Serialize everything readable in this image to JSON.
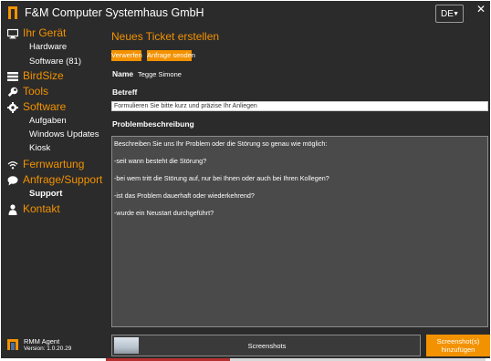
{
  "window": {
    "title": "F&M Computer Systemhaus GmbH"
  },
  "language": {
    "selected": "DE"
  },
  "sidebar": {
    "sections": [
      {
        "label": "Ihr Gerät",
        "icon": "monitor-icon"
      },
      {
        "label": "BirdSize",
        "icon": "list-icon"
      },
      {
        "label": "Tools",
        "icon": "wrench-icon"
      },
      {
        "label": "Software",
        "icon": "gear-icon"
      },
      {
        "label": "Fernwartung",
        "icon": "wifi-icon"
      },
      {
        "label": "Anfrage/Support",
        "icon": "chat-icon"
      },
      {
        "label": "Kontakt",
        "icon": "person-icon"
      }
    ],
    "device_items": [
      "Hardware",
      "Software (81)"
    ],
    "software_items": [
      "Aufgaben",
      "Windows Updates",
      "Kiosk"
    ],
    "support_items": [
      "Support"
    ]
  },
  "agent": {
    "name": "RMM Agent",
    "version": "Version:   1.0.20.29"
  },
  "main": {
    "title": "Neues Ticket erstellen",
    "discard_label": "Verwerfen",
    "send_label": "Anfrage senden",
    "name_label": "Name",
    "name_value": "Tegge Simone",
    "subject_label": "Betreff",
    "subject_value": "Formulieren Sie bitte kurz und präzise Ihr Anliegen",
    "description_label": "Problembeschreibung",
    "description_lines": [
      "Beschreiben Sie uns Ihr Problem oder die Störung so genau wie möglich:",
      "-seit wann besteht die Störung?",
      "-bei wem tritt die Störung auf, nur bei Ihnen oder auch bei Ihren Kollegen?",
      "-ist das Problem dauerhaft oder wiederkehrend?",
      "-wurde ein Neustart durchgeführt?"
    ],
    "screenshots_label": "Screenshots",
    "add_screenshot_line1": "Screenshot(s)",
    "add_screenshot_line2": "hinzufügen"
  },
  "colors": {
    "accent": "#f39200",
    "background": "#2b2b2b",
    "text": "#ffffff"
  }
}
